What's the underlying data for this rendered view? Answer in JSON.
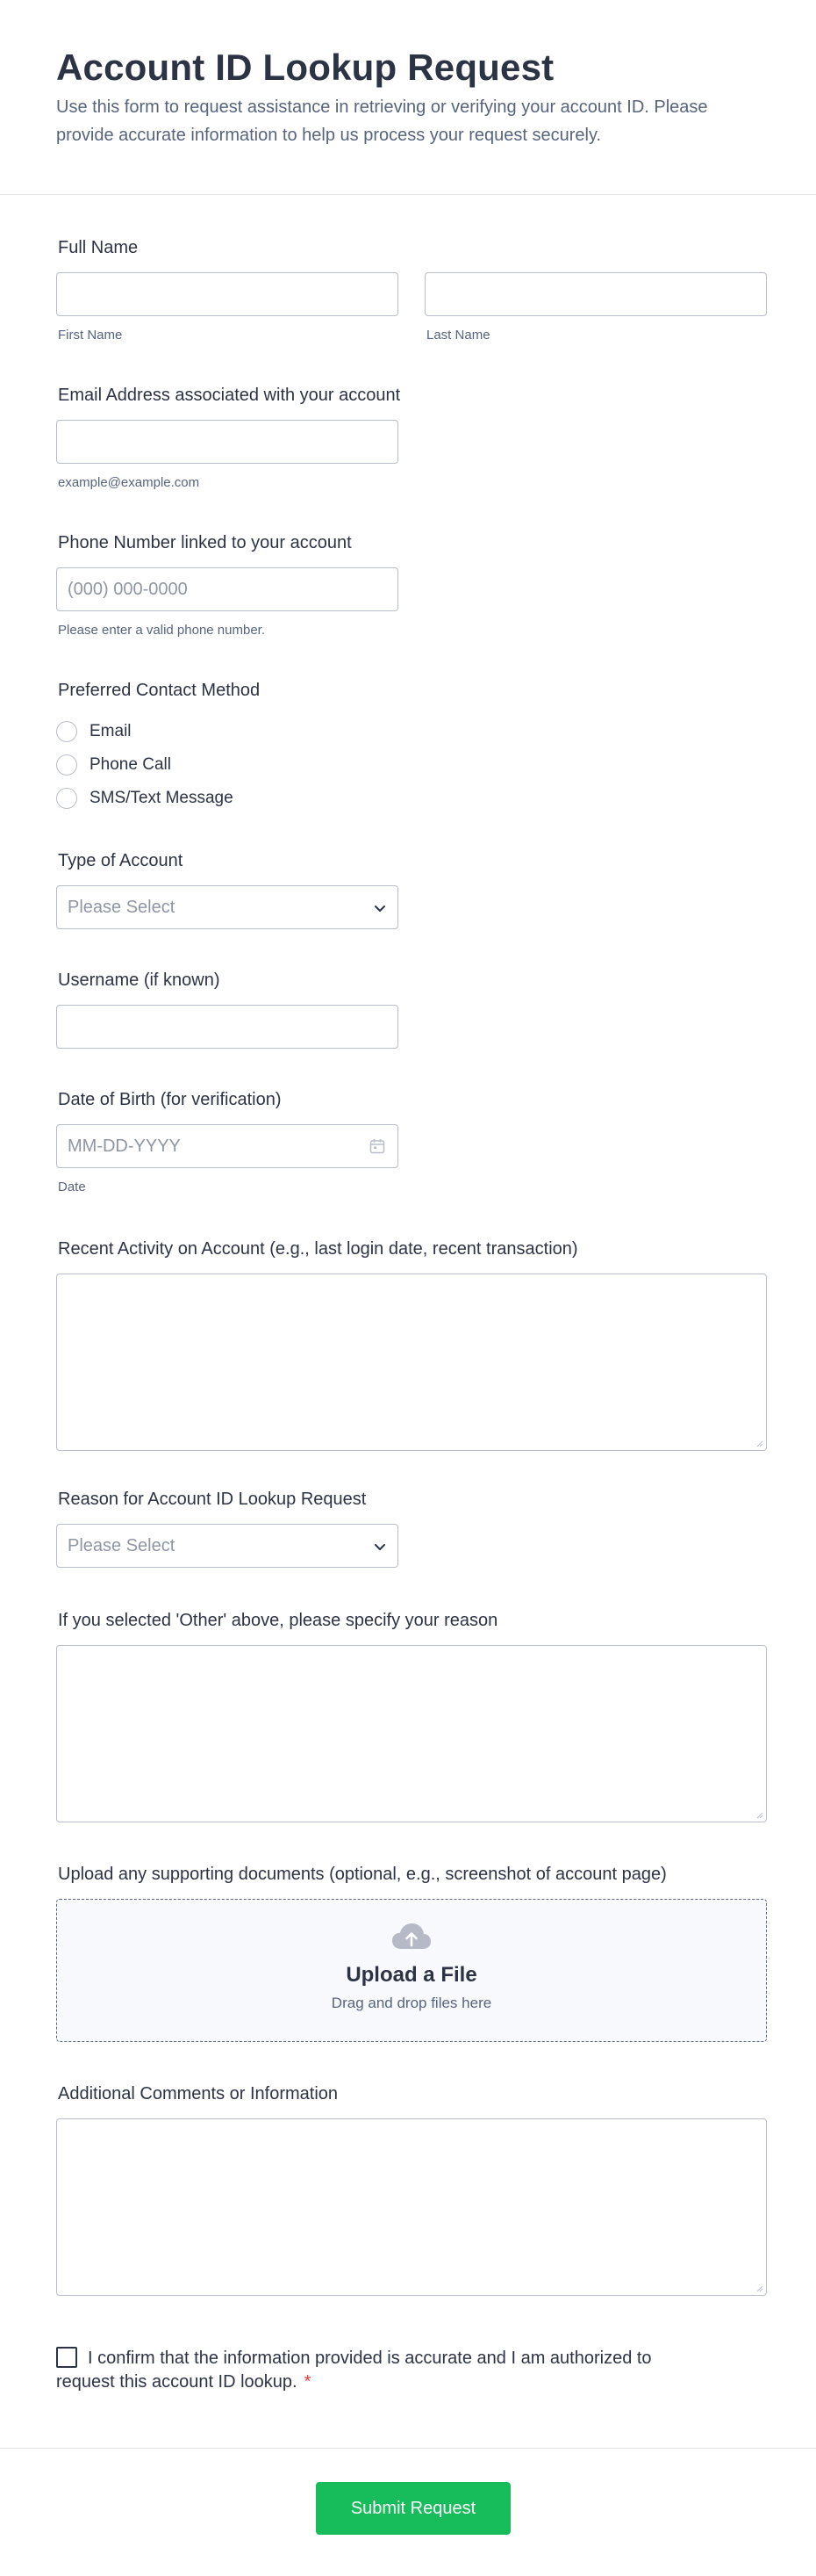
{
  "header": {
    "title": "Account ID Lookup Request",
    "subtitle": "Use this form to request assistance in retrieving or verifying your account ID. Please provide accurate information to help us process your request securely."
  },
  "full_name": {
    "label": "Full Name",
    "first_sublabel": "First Name",
    "last_sublabel": "Last Name"
  },
  "email": {
    "label": "Email Address associated with your account",
    "sublabel": "example@example.com"
  },
  "phone": {
    "label": "Phone Number linked to your account",
    "placeholder": "(000) 000-0000",
    "sublabel": "Please enter a valid phone number."
  },
  "contact_method": {
    "label": "Preferred Contact Method",
    "options": [
      "Email",
      "Phone Call",
      "SMS/Text Message"
    ]
  },
  "account_type": {
    "label": "Type of Account",
    "placeholder": "Please Select"
  },
  "username": {
    "label": "Username (if known)"
  },
  "dob": {
    "label": "Date of Birth (for verification)",
    "placeholder": "MM-DD-YYYY",
    "sublabel": "Date"
  },
  "recent_activity": {
    "label": "Recent Activity on Account (e.g., last login date, recent transaction)"
  },
  "reason": {
    "label": "Reason for Account ID Lookup Request",
    "placeholder": "Please Select"
  },
  "other_reason": {
    "label": "If you selected 'Other' above, please specify your reason"
  },
  "upload": {
    "label": "Upload any supporting documents (optional, e.g., screenshot of account page)",
    "title": "Upload a File",
    "subtitle": "Drag and drop files here"
  },
  "comments": {
    "label": "Additional Comments or Information"
  },
  "confirm": {
    "text": "I confirm that the information provided is accurate and I am authorized to request this account ID lookup.",
    "required_mark": "*"
  },
  "footer": {
    "submit_label": "Submit Request"
  },
  "colors": {
    "submit": "#18bd5b",
    "required": "#f23a3c",
    "text": "#2c3345",
    "muted": "#57647e"
  }
}
